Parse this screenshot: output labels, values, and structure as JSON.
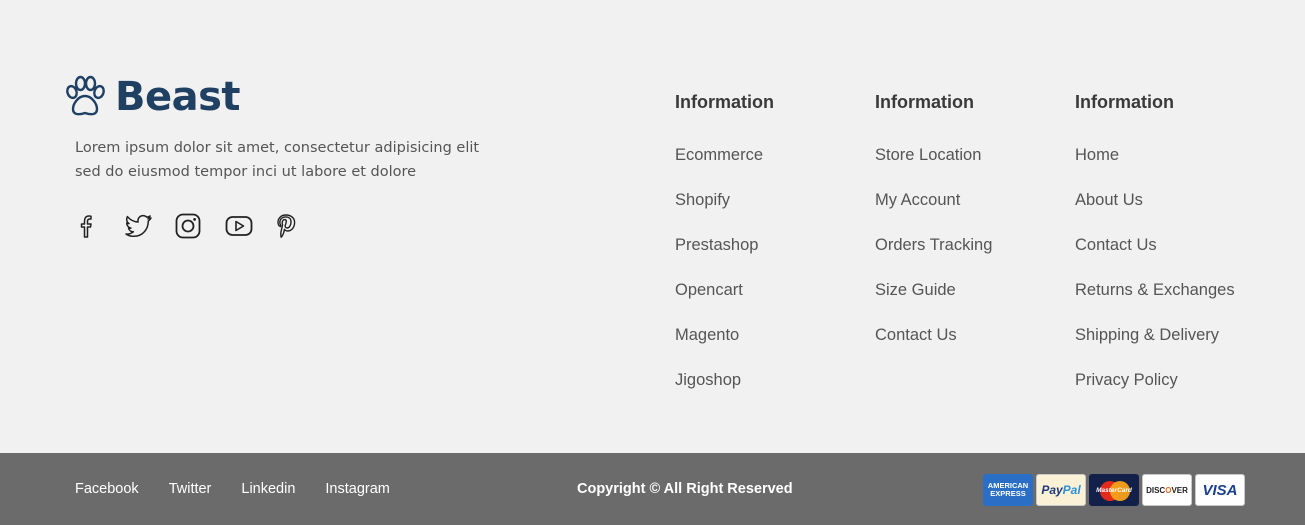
{
  "brand": {
    "name": "Beast",
    "tagline": "Lorem ipsum dolor sit amet, consectetur adipisicing elit sed do eiusmod tempor inci ut labore et dolore",
    "logo_color": "#1f3f63"
  },
  "socials": [
    {
      "icon": "facebook-icon"
    },
    {
      "icon": "twitter-icon"
    },
    {
      "icon": "instagram-icon"
    },
    {
      "icon": "youtube-icon"
    },
    {
      "icon": "pinterest-icon"
    }
  ],
  "columns": [
    {
      "title": "Information",
      "items": [
        "Ecommerce",
        "Shopify",
        "Prestashop",
        "Opencart",
        "Magento",
        "Jigoshop"
      ]
    },
    {
      "title": "Information",
      "items": [
        "Store Location",
        "My Account",
        "Orders Tracking",
        "Size Guide",
        "Contact Us"
      ]
    },
    {
      "title": "Information",
      "items": [
        "Home",
        "About Us",
        "Contact Us",
        "Returns & Exchanges",
        "Shipping & Delivery",
        "Privacy Policy"
      ]
    }
  ],
  "bottom": {
    "links": [
      "Facebook",
      "Twitter",
      "Linkedin",
      "Instagram"
    ],
    "copyright": "Copyright  © All Right Reserved",
    "background": "#6b6b6b"
  },
  "payments": {
    "amex": "AMERICAN EXPRESS",
    "amex_line1": "AMERICAN",
    "amex_line2": "EXPRESS",
    "paypal_1": "Pay",
    "paypal_2": "Pal",
    "mastercard": "MasterCard",
    "discover_1": "DISC",
    "discover_2": "O",
    "discover_3": "VER",
    "visa": "VISA"
  }
}
